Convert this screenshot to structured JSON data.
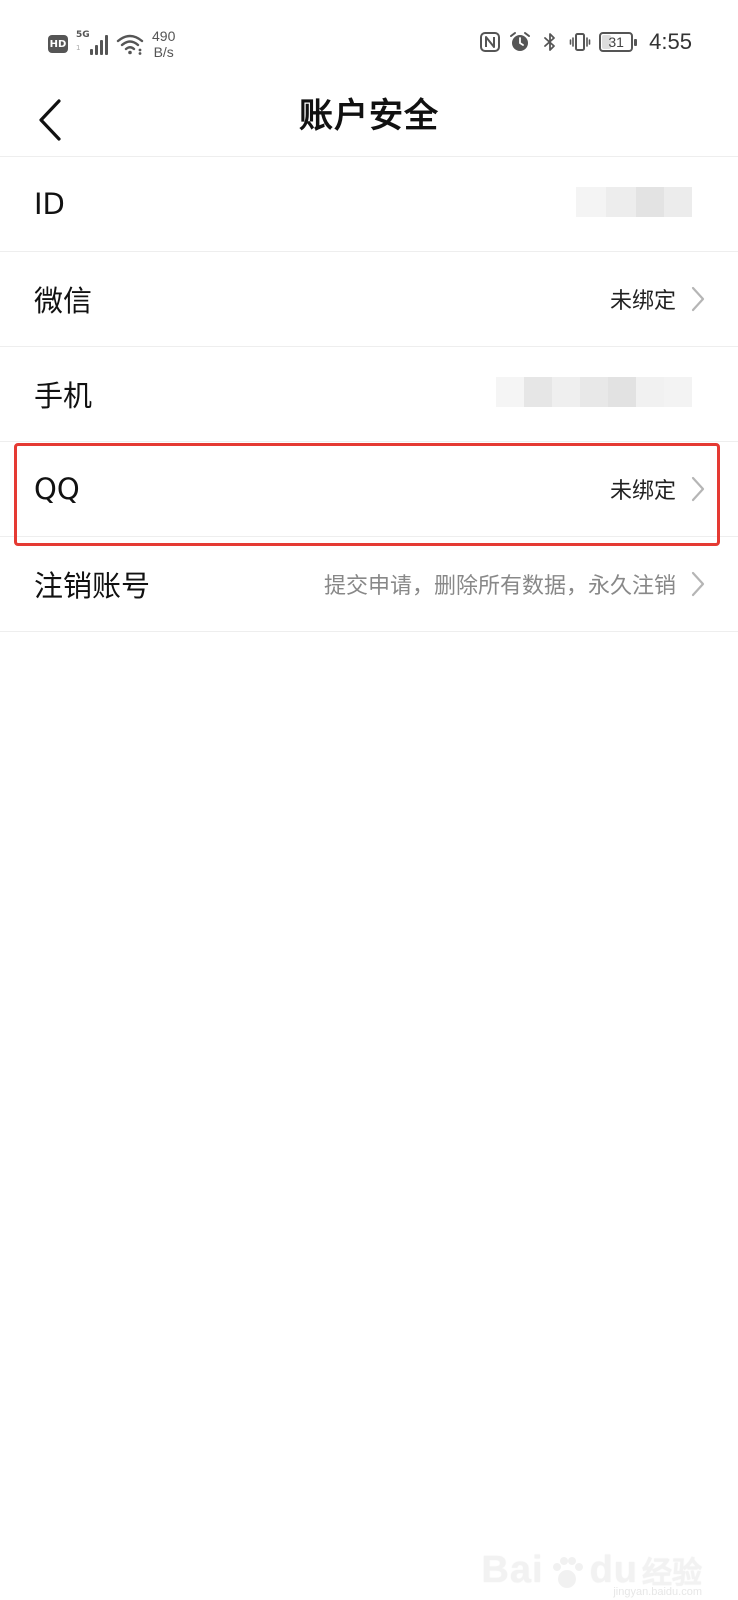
{
  "status_bar": {
    "hd": "HD",
    "network": "5G",
    "network_sub": "1",
    "speed_value": "490",
    "speed_unit": "B/s",
    "battery": "31",
    "battery_level_percent": 31,
    "time": "4:55",
    "icons": [
      "nfc-icon",
      "alarm-icon",
      "bluetooth-icon",
      "vibrate-icon"
    ]
  },
  "header": {
    "title": "账户安全",
    "back_icon": "chevron-left-icon"
  },
  "list": {
    "rows": [
      {
        "label": "ID",
        "value": "",
        "obscured": true
      },
      {
        "label": "微信",
        "value": "未绑定"
      },
      {
        "label": "手机",
        "value": "",
        "obscured": true
      },
      {
        "label": "QQ",
        "value": "未绑定"
      },
      {
        "label": "注销账号",
        "value": "提交申请，删除所有数据，永久注销"
      }
    ]
  },
  "watermark": {
    "brand": "Bai",
    "brand2": "du",
    "product": "经验",
    "url": "jingyan.baidu.com"
  },
  "colors": {
    "highlight": "#e53a33",
    "divider": "#eeeeee",
    "muted_text": "#888888",
    "chevron": "#b5b5b5"
  }
}
